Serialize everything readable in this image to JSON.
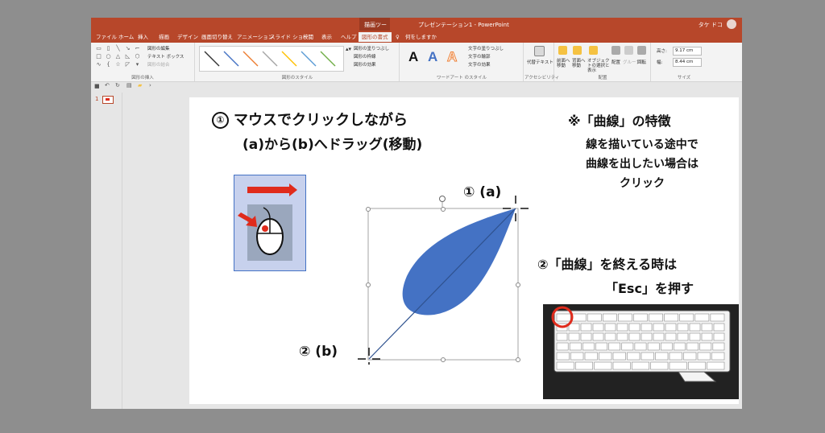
{
  "titlebar": {
    "context_tab": "描画ツール",
    "doc_title": "プレゼンテーション1 - PowerPoint",
    "user": "タケ ドコ"
  },
  "tabs": [
    "ファイル",
    "ホーム",
    "挿入",
    "描画",
    "デザイン",
    "画面切り替え",
    "アニメーション",
    "スライド ショー",
    "校閲",
    "表示",
    "ヘルプ",
    "図形の書式"
  ],
  "tell_me": "何をしますか",
  "ribbon": {
    "insert_shapes": {
      "label": "図形の挿入",
      "edit_shape": "図形の編集",
      "text_box": "テキスト ボックス",
      "merge_shapes": "図形の結合"
    },
    "shape_styles": {
      "label": "図形のスタイル",
      "fill": "図形の塗りつぶし",
      "outline": "図形の枠線",
      "effects": "図形の効果"
    },
    "wordart": {
      "label": "ワードアート のスタイル",
      "text_fill": "文字の塗りつぶし",
      "text_outline": "文字の輪郭",
      "text_effects": "文字の効果"
    },
    "accessibility": {
      "label": "アクセシビリティ",
      "alt_text": "代替テキスト"
    },
    "arrange": {
      "label": "配置",
      "bring_forward": "前面へ移動",
      "send_backward": "背面へ移動",
      "selection_pane": "オブジェクトの選択と表示",
      "align": "配置",
      "group": "グループ化",
      "rotate": "回転"
    },
    "size": {
      "label": "サイズ",
      "height_label": "高さ:",
      "height": "9.17 cm",
      "width_label": "幅:",
      "width": "8.44 cm"
    }
  },
  "slide_panel": {
    "slide_number": "1"
  },
  "slide": {
    "step1_num": "①",
    "step1_line1": "マウスでクリックしながら",
    "step1_line2": "(a)から(b)へドラッグ(移動)",
    "note_title": "※「曲線」の特徴",
    "note_line1": "線を描いている途中で",
    "note_line2": "曲線を出したい場合は",
    "note_line3": "クリック",
    "label_a": "① (a)",
    "label_b": "② (b)",
    "step2_line1": "②「曲線」を終える時は",
    "step2_line2": "「Esc」を押す"
  },
  "colors": {
    "accent": "#b7472a",
    "leaf": "#4472c4",
    "arrow": "#e02b1c"
  },
  "icons": [
    "save-icon",
    "undo-icon",
    "redo-icon",
    "rotate-handle-icon",
    "crosshair-icon",
    "mouse-icon",
    "keyboard-icon"
  ]
}
